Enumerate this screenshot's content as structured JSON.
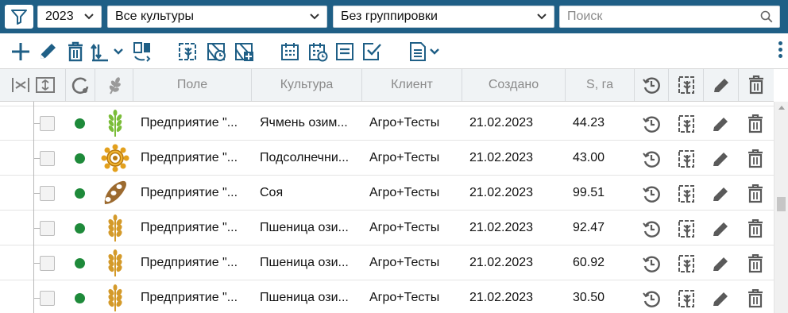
{
  "filters": {
    "year": "2023",
    "culture": "Все культуры",
    "grouping": "Без группировки",
    "search_placeholder": "Поиск"
  },
  "colors": {
    "brand": "#1f5f86",
    "status_green": "#1e8a3a",
    "crop_gold": "#d49a2a",
    "crop_green": "#7bbd3a",
    "soy_brown": "#9c6a2f"
  },
  "table": {
    "columns": [
      "Поле",
      "Культура",
      "Клиент",
      "Создано",
      "S, га"
    ],
    "rows": [
      {
        "field": "Предприятие \"...",
        "culture": "Ячмень озим...",
        "client": "Агро+Тесты",
        "created": "21.02.2023",
        "area": "44.23",
        "crop_icon": "barley-icon"
      },
      {
        "field": "Предприятие \"...",
        "culture": "Подсолнечни...",
        "client": "Агро+Тесты",
        "created": "21.02.2023",
        "area": "43.00",
        "crop_icon": "sunflower-icon"
      },
      {
        "field": "Предприятие \"...",
        "culture": "Соя",
        "client": "Агро+Тесты",
        "created": "21.02.2023",
        "area": "99.51",
        "crop_icon": "soy-icon"
      },
      {
        "field": "Предприятие \"...",
        "culture": "Пшеница ози...",
        "client": "Агро+Тесты",
        "created": "21.02.2023",
        "area": "92.47",
        "crop_icon": "wheat-icon"
      },
      {
        "field": "Предприятие \"...",
        "culture": "Пшеница ози...",
        "client": "Агро+Тесты",
        "created": "21.02.2023",
        "area": "60.92",
        "crop_icon": "wheat-icon"
      },
      {
        "field": "Предприятие \"...",
        "culture": "Пшеница ози...",
        "client": "Агро+Тесты",
        "created": "21.02.2023",
        "area": "30.50",
        "crop_icon": "wheat-icon"
      }
    ]
  }
}
